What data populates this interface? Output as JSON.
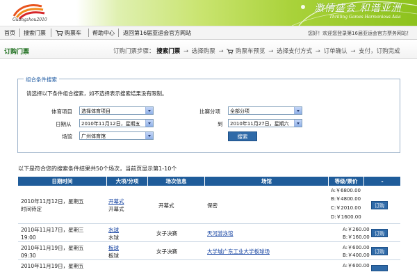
{
  "banner": {
    "logo_text": "Guangzhou2010",
    "slogan": "激情盛会 和谐亚洲",
    "slogan_sub": "Thrilling Games  Harmonious Asia"
  },
  "nav": {
    "items": [
      "首页",
      "搜索门票",
      "购票车",
      "帮助中心",
      "返回第16届亚运会官方网站"
    ],
    "welcome": "您好！欢迎您登录第16届亚运会官方票务网站！"
  },
  "stepbar": {
    "title": "订购门票",
    "steps_prefix": "订购门票步骤：",
    "steps": [
      "搜索门票",
      "选择购票",
      "购票车预览",
      "选择支付方式",
      "订单确认",
      "支付，订购完成"
    ]
  },
  "search": {
    "legend": "组合条件搜索",
    "hint": "请选择以下条件组合搜索，如不选择表示搜索结果没有限制。",
    "sport_label": "体育项目",
    "sport_value": "选择体育项目",
    "event_label": "比赛分项",
    "event_value": "全部分项",
    "date_from_label": "日期从",
    "date_from_value": "2010年11月12日，星期五",
    "date_to_label": "到",
    "date_to_value": "2010年11月27日，星期六",
    "venue_label": "场馆",
    "venue_value": "广州体育馆",
    "search_button": "搜索"
  },
  "results": {
    "summary": "以下是符合您的搜索条件结果共50个场次，当前页显示第1-10个",
    "headers": [
      "日期时间",
      "大项/分项",
      "场次信息",
      "场馆",
      "等级/票价",
      "-"
    ],
    "rows": [
      {
        "date": "2010年11月12日，星期五",
        "time": "时间待定",
        "sport": "开幕式",
        "sub": "开幕式",
        "session": "开幕式",
        "venue": "保密",
        "venue_link": false,
        "prices": [
          "A:￥6800.00",
          "B:￥4800.00",
          "C:￥2010.00",
          "D:￥1600.00"
        ],
        "buy": "订购"
      },
      {
        "date": "2010年11月17日，星期三",
        "time": "19:00",
        "sport": "水球",
        "sub": "水球",
        "session": "女子决赛",
        "venue": "天河游泳馆",
        "venue_link": true,
        "prices": [
          "A:￥260.00",
          "B:￥160.00"
        ],
        "buy": "订购"
      },
      {
        "date": "2010年11月19日，星期五",
        "time": "09:30",
        "sport": "板球",
        "sub": "板球",
        "session": "女子决赛",
        "venue": "大学城广东工业大学板球场",
        "venue_link": true,
        "prices": [
          "A:￥600.00",
          "B:￥400.00"
        ],
        "buy": "订购"
      },
      {
        "date": "2010年11月19日，星期五",
        "time": "",
        "sport": "",
        "sub": "",
        "session": "",
        "venue": "",
        "venue_link": false,
        "prices": [
          "A:￥600.00"
        ],
        "buy": ""
      }
    ]
  },
  "colors": {
    "accent": "#1f5c9a",
    "title_green": "#1f6f1f",
    "link": "#1240a0"
  }
}
